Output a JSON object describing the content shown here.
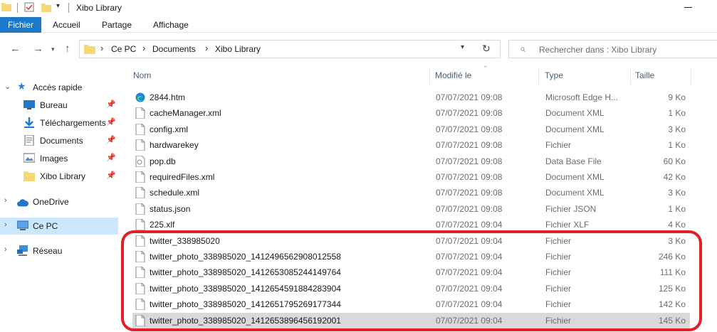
{
  "window": {
    "title": "Xibo Library",
    "minimize_glyph": "—"
  },
  "ribbon": {
    "tabs": [
      "Fichier",
      "Accueil",
      "Partage",
      "Affichage"
    ]
  },
  "address": {
    "crumbs": [
      "Ce PC",
      "Documents",
      "Xibo Library"
    ],
    "sep": "›"
  },
  "search": {
    "placeholder": "Rechercher dans : Xibo Library"
  },
  "nav": {
    "quick_access": "Accès rapide",
    "items": [
      {
        "label": "Bureau",
        "icon": "desktop-icon"
      },
      {
        "label": "Téléchargements",
        "icon": "download-icon"
      },
      {
        "label": "Documents",
        "icon": "documents-icon"
      },
      {
        "label": "Images",
        "icon": "images-icon"
      },
      {
        "label": "Xibo Library",
        "icon": "folder-icon"
      }
    ],
    "onedrive": "OneDrive",
    "this_pc": "Ce PC",
    "network": "Réseau"
  },
  "columns": {
    "name": "Nom",
    "modified": "Modifié le",
    "type": "Type",
    "size": "Taille"
  },
  "files": [
    {
      "name": "2844.htm",
      "date": "07/07/2021 09:08",
      "type": "Microsoft Edge H...",
      "size": "9 Ko",
      "icon": "edge-icon"
    },
    {
      "name": "cacheManager.xml",
      "date": "07/07/2021 09:08",
      "type": "Document XML",
      "size": "1 Ko",
      "icon": "file-icon"
    },
    {
      "name": "config.xml",
      "date": "07/07/2021 09:08",
      "type": "Document XML",
      "size": "3 Ko",
      "icon": "file-icon"
    },
    {
      "name": "hardwarekey",
      "date": "07/07/2021 09:08",
      "type": "Fichier",
      "size": "1 Ko",
      "icon": "file-icon"
    },
    {
      "name": "pop.db",
      "date": "07/07/2021 09:08",
      "type": "Data Base File",
      "size": "60 Ko",
      "icon": "db-file-icon"
    },
    {
      "name": "requiredFiles.xml",
      "date": "07/07/2021 09:08",
      "type": "Document XML",
      "size": "42 Ko",
      "icon": "file-icon"
    },
    {
      "name": "schedule.xml",
      "date": "07/07/2021 09:08",
      "type": "Document XML",
      "size": "3 Ko",
      "icon": "file-icon"
    },
    {
      "name": "status.json",
      "date": "07/07/2021 09:08",
      "type": "Fichier JSON",
      "size": "1 Ko",
      "icon": "file-icon"
    },
    {
      "name": "225.xlf",
      "date": "07/07/2021 09:04",
      "type": "Fichier XLF",
      "size": "4 Ko",
      "icon": "file-icon"
    },
    {
      "name": "twitter_338985020",
      "date": "07/07/2021 09:04",
      "type": "Fichier",
      "size": "3 Ko",
      "icon": "file-icon"
    },
    {
      "name": "twitter_photo_338985020_1412496562908012558",
      "date": "07/07/2021 09:04",
      "type": "Fichier",
      "size": "246 Ko",
      "icon": "file-icon"
    },
    {
      "name": "twitter_photo_338985020_1412653085244149764",
      "date": "07/07/2021 09:04",
      "type": "Fichier",
      "size": "111 Ko",
      "icon": "file-icon"
    },
    {
      "name": "twitter_photo_338985020_1412654591884283904",
      "date": "07/07/2021 09:04",
      "type": "Fichier",
      "size": "125 Ko",
      "icon": "file-icon"
    },
    {
      "name": "twitter_photo_338985020_1412651795269177344",
      "date": "07/07/2021 09:04",
      "type": "Fichier",
      "size": "142 Ko",
      "icon": "file-icon"
    },
    {
      "name": "twitter_photo_338985020_1412653896456192001",
      "date": "07/07/2021 09:04",
      "type": "Fichier",
      "size": "145 Ko",
      "icon": "file-icon"
    }
  ],
  "selected_row": 14,
  "colors": {
    "accent": "#1979ca",
    "nav_selected": "#cce8ff",
    "row_highlight": "#d9d9d9",
    "annotation": "#e11f26",
    "folder": "#f8d775"
  }
}
